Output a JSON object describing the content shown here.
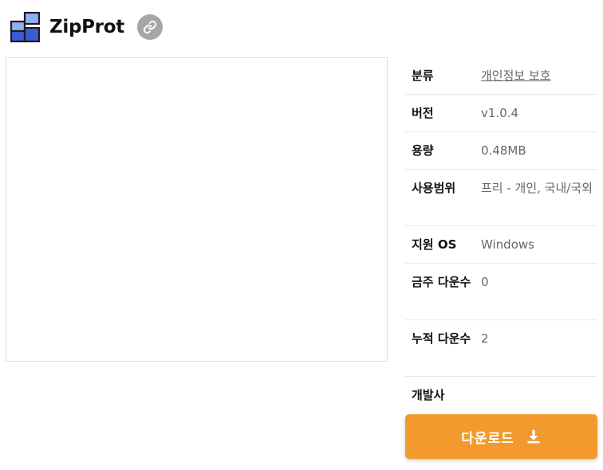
{
  "app": {
    "title": "ZipProt"
  },
  "info": [
    {
      "label": "분류",
      "value": "개인정보 보호",
      "is_link": true
    },
    {
      "label": "버전",
      "value": "v1.0.4"
    },
    {
      "label": "용량",
      "value": "0.48MB"
    },
    {
      "label": "사용범위",
      "value": "프리 - 개인, 국내/국외"
    },
    {
      "label": "지원 OS",
      "value": "Windows"
    },
    {
      "label": "금주 다운수",
      "value": "0"
    },
    {
      "label": "누적 다운수",
      "value": "2"
    },
    {
      "label": "개발사",
      "value": ""
    }
  ],
  "download": {
    "label": "다운로드"
  },
  "colors": {
    "accent": "#f39a2e",
    "logo_dark": "#3b5bd6",
    "logo_light": "#8fb0f5",
    "link_button": "#a6a6a6"
  },
  "icons": {
    "logo": "app-logo",
    "link": "link-icon",
    "download": "download-icon"
  }
}
